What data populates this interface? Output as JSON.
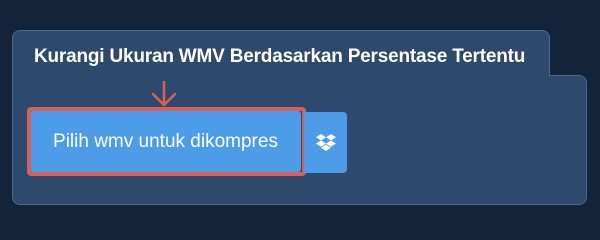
{
  "card": {
    "title": "Kurangi Ukuran WMV Berdasarkan Persentase Tertentu"
  },
  "upload": {
    "button_label": "Pilih wmv untuk dikompres",
    "dropbox_icon": "dropbox-icon"
  },
  "annotation": {
    "arrow_icon": "down-arrow-icon",
    "highlight_color": "#d9605a"
  },
  "colors": {
    "background": "#13243a",
    "card": "#2d4a6c",
    "button": "#4d9ce8"
  }
}
